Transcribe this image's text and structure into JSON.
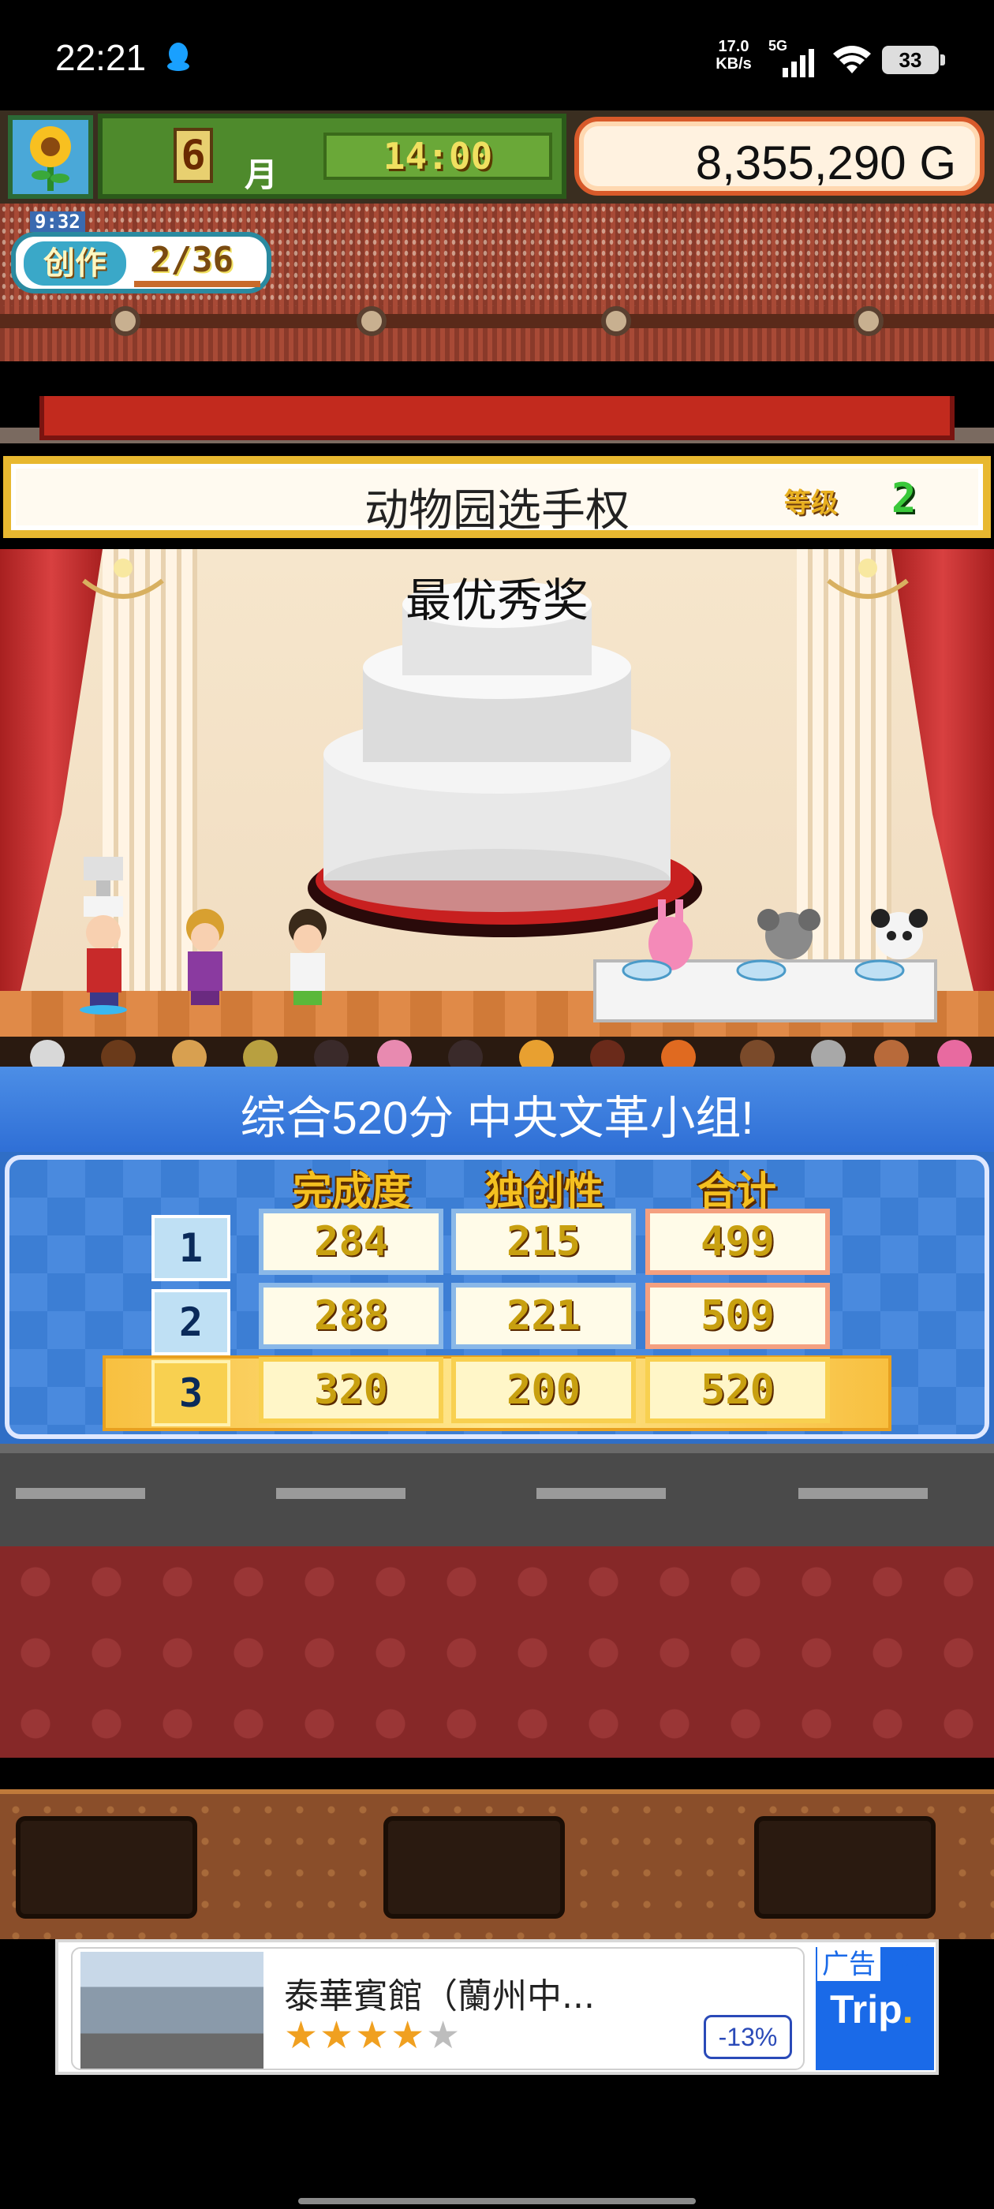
{
  "status_bar": {
    "time": "22:21",
    "net_speed_value": "17.0",
    "net_speed_unit": "KB/s",
    "network_type": "5G",
    "battery": "33"
  },
  "hud": {
    "month_number": "6",
    "month_label": "月",
    "clock": "14:00",
    "money": "8,355,290 G"
  },
  "production": {
    "timer": "9:32",
    "label": "创作",
    "progress": "2/36"
  },
  "contest": {
    "title": "动物园选手权",
    "grade_label": "等级",
    "grade_value": "2",
    "award": "最优秀奖"
  },
  "result": {
    "summary": "综合520分 中央文革小组!"
  },
  "score_table": {
    "headers": [
      "完成度",
      "独创性",
      "合计"
    ],
    "rows": [
      {
        "rank": "1",
        "completion": "284",
        "originality": "215",
        "total": "499"
      },
      {
        "rank": "2",
        "completion": "288",
        "originality": "221",
        "total": "509"
      },
      {
        "rank": "3",
        "completion": "320",
        "originality": "200",
        "total": "520"
      }
    ],
    "highlighted_rank": "3"
  },
  "ad": {
    "title": "泰華賓館（蘭州中...",
    "rating_stars": 4,
    "rating_max": 5,
    "discount": "-13%",
    "tag": "广告",
    "close": "✕",
    "brand": "Trip",
    "brand_dot": "."
  },
  "colors": {
    "hud_green": "#4e8a2c",
    "banner_gold": "#e8b830",
    "result_blue": "#2f6fd6",
    "score_gold": "#c8a010",
    "ad_blue": "#1a6ae8"
  }
}
